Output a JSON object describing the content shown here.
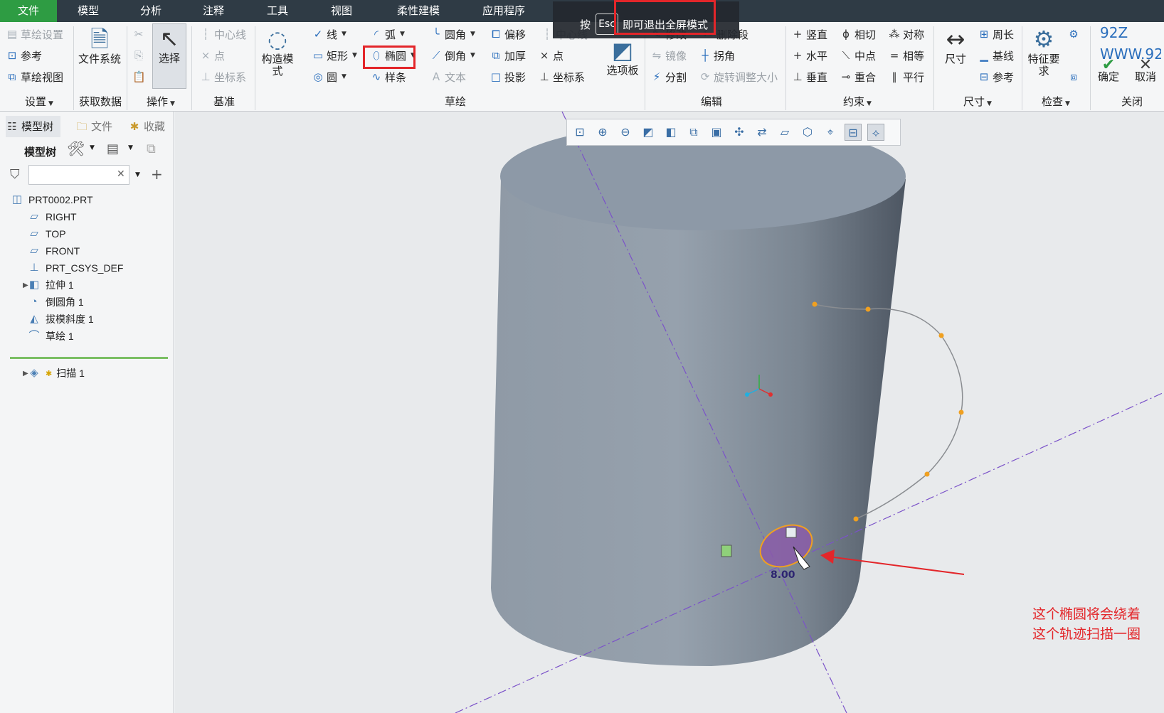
{
  "menubar": {
    "items": [
      "文件",
      "模型",
      "分析",
      "注释",
      "工具",
      "视图",
      "柔性建模",
      "应用程序"
    ]
  },
  "esc_overlay": {
    "press": "按",
    "key": "Esc",
    "message": "即可退出全屏模式"
  },
  "ribbon": {
    "settings": {
      "sketch_setup": "草绘设置",
      "references": "参考",
      "sketch_view": "草绘视图",
      "title": "设置"
    },
    "get_data": {
      "file_system": "文件系统",
      "title": "获取数据"
    },
    "operations": {
      "select": "选择",
      "title": "操作"
    },
    "datum": {
      "centerline": "中心线",
      "point": "点",
      "csys": "坐标系",
      "title": "基准"
    },
    "construction": {
      "label": "构造模式"
    },
    "sketching": {
      "line": "线",
      "arc": "弧",
      "fillet": "圆角",
      "offset": "偏移",
      "centerline": "中心线",
      "rectangle": "矩形",
      "ellipse": "椭圆",
      "chamfer": "倒角",
      "thicken": "加厚",
      "point": "点",
      "circle": "圆",
      "spline": "样条",
      "text": "文本",
      "project": "投影",
      "csys": "坐标系",
      "palette": "选项板",
      "title": "草绘"
    },
    "editing": {
      "modify": "修改",
      "delete_segment": "删除段",
      "mirror": "镜像",
      "corner": "拐角",
      "divide": "分割",
      "rotate_resize": "旋转调整大小",
      "title": "编辑"
    },
    "constraints": {
      "vertical": "竖直",
      "tangent": "相切",
      "symmetric": "对称",
      "horizontal": "水平",
      "midpoint": "中点",
      "equal": "相等",
      "perpendicular": "垂直",
      "coincident": "重合",
      "parallel": "平行",
      "title": "约束"
    },
    "dimension": {
      "dimension": "尺寸",
      "perimeter": "周长",
      "baseline": "基线",
      "reference": "参考",
      "title": "尺寸"
    },
    "inspect": {
      "feature_req": "特征要求",
      "title": "检查"
    },
    "close": {
      "ok": "确定",
      "cancel": "取消",
      "title": "关闭",
      "watermark": "92Z\nWWW.92"
    }
  },
  "left_panel": {
    "tabs": [
      "模型树",
      "文件",
      "收藏"
    ],
    "header": "模型树",
    "search_placeholder": "",
    "tree": [
      {
        "label": "PRT0002.PRT",
        "icon": "part-icon"
      },
      {
        "label": "RIGHT",
        "icon": "plane-icon"
      },
      {
        "label": "TOP",
        "icon": "plane-icon"
      },
      {
        "label": "FRONT",
        "icon": "plane-icon"
      },
      {
        "label": "PRT_CSYS_DEF",
        "icon": "csys-icon"
      },
      {
        "label": "拉伸 1",
        "icon": "extrude-icon"
      },
      {
        "label": "倒圆角 1",
        "icon": "round-icon"
      },
      {
        "label": "拔模斜度 1",
        "icon": "draft-icon"
      },
      {
        "label": "草绘 1",
        "icon": "sketch-icon"
      },
      {
        "label": "扫描 1",
        "icon": "sweep-icon"
      }
    ]
  },
  "viewport": {
    "dimension_value": "8.00",
    "annotation": "这个椭圆将会绕着\n这个轨迹扫描一圈"
  },
  "colors": {
    "highlight": "#e3262a",
    "menubar": "#2f3b45",
    "file_tab": "#2e9c43",
    "model": "#8a95a1"
  }
}
